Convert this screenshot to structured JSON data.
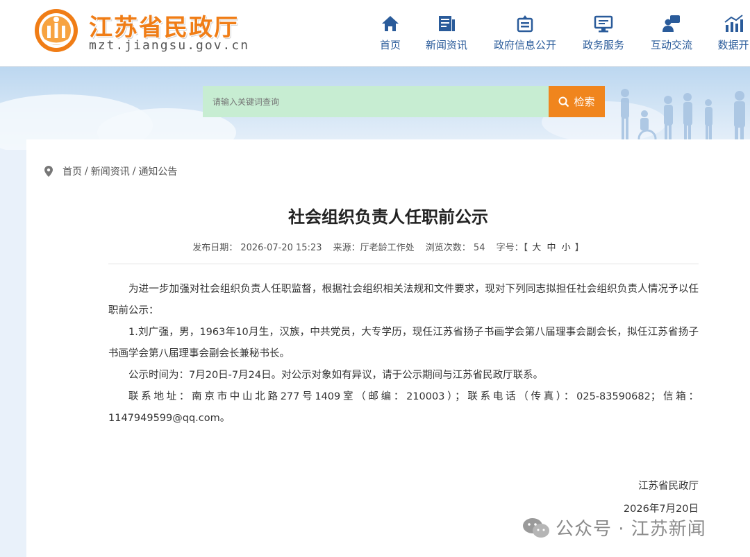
{
  "header": {
    "site_title": "江苏省民政厅",
    "site_url": "mzt.jiangsu.gov.cn",
    "nav": [
      {
        "label": "首页",
        "icon": "home-icon"
      },
      {
        "label": "新闻资讯",
        "icon": "news-icon"
      },
      {
        "label": "政府信息公开",
        "icon": "government-info-icon"
      },
      {
        "label": "政务服务",
        "icon": "service-monitor-icon"
      },
      {
        "label": "互动交流",
        "icon": "interaction-icon"
      },
      {
        "label": "数据开",
        "icon": "data-chart-icon"
      }
    ]
  },
  "search": {
    "placeholder": "请输入关键词查询",
    "button_label": "检索"
  },
  "breadcrumb": {
    "home": "首页",
    "news": "新闻资讯",
    "current": "通知公告",
    "separator": "/"
  },
  "article": {
    "title": "社会组织负责人任职前公示",
    "meta": {
      "date": "发布日期： 2026-07-20 15:23",
      "source": "来源：厅老龄工作处",
      "views": "浏览次数： 54",
      "font_size_label": "字号：",
      "font_sizes": [
        "【",
        "大",
        "中",
        "小",
        "】"
      ]
    },
    "paragraphs": [
      "为进一步加强对社会组织负责人任职监督，根据社会组织相关法规和文件要求，现对下列同志拟担任社会组织负责人情况予以任职前公示：",
      "1.刘广强，男，1963年10月生，汉族，中共党员，大专学历，现任江苏省扬子书画学会第八届理事会副会长，拟任江苏省扬子书画学会第八届理事会副会长兼秘书长。",
      "公示时间为：7月20日-7月24日。对公示对象如有异议，请于公示期间与江苏省民政厅联系。",
      "联系地址：南京市中山北路277号1409室（邮编：210003）；联系电话（传真）：025-83590682；信箱：",
      "1147949599@qq.com。"
    ],
    "signature": "江苏省民政厅",
    "sign_date": "2026年7月20日"
  },
  "watermark": "公众号 · 江苏新闻",
  "colors": {
    "brand_orange": "#f07d16",
    "nav_blue": "#2a5b9a",
    "search_bg": "#c7edd2",
    "search_button": "#f0851d"
  }
}
